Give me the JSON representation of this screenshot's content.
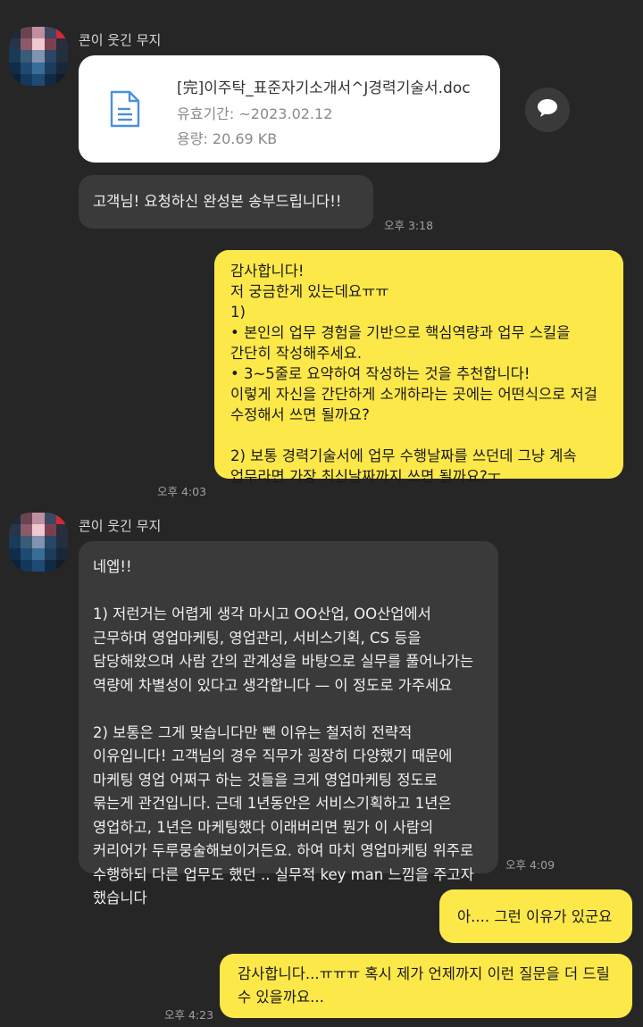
{
  "messages": [
    {
      "sender": "콘이 웃긴 무지",
      "file": {
        "name": "[完]이주탁_표준자기소개서^J경력기술서.doc",
        "expiry": "유효기간: ~2023.02.12",
        "size": "용량: 20.69 KB"
      }
    },
    {
      "text": "고객님! 요청하신 완성본 송부드립니다!!",
      "time": "오후 3:18"
    },
    {
      "text": "감사합니다!\n저 궁금한게 있는데요ㅠㅠ\n1)\n• 본인의 업무 경험을 기반으로 핵심역량과 업무 스킬을 간단히 작성해주세요.\n• 3~5줄로 요약하여 작성하는 것을 추천합니다!\n이렇게 자신을 간단하게 소개하라는 곳에는 어떤식으로 저걸 수정해서 쓰면 될까요?\n\n2) 보통 경력기술서에 업무 수행날짜를 쓰던데 그냥 계속 업무라면 가장 최신날짜까지 쓰면 될까요?ㅜ",
      "time": "오후 4:03"
    },
    {
      "sender": "콘이 웃긴 무지",
      "text": "네엡!!\n\n1) 저런거는 어렵게 생각 마시고 OO산업, OO산업에서 근무하며 영업마케팅, 영업관리, 서비스기획, CS 등을 담당해왔으며 사람 간의 관계성을 바탕으로 실무를 풀어나가는 역량에 차별성이 있다고 생각합니다 — 이 정도로 가주세요\n\n2) 보통은 그게 맞습니다만 뺀 이유는 철저히 전략적 이유입니다! 고객님의 경우 직무가 굉장히 다양했기 때문에 마케팅 영업 어쩌구 하는 것들을 크게 영업마케팅 정도로 묶는게 관건입니다. 근데 1년동안은 서비스기획하고 1년은 영업하고, 1년은 마케팅했다 이래버리면 뭔가 이 사람의 커리어가 두루뭉술해보이거든요. 하여 마치 영업마케팅 위주로 수행하되 다른 업무도 했던 .. 실무적 key man 느낌을 주고자 했습니다",
      "time": "오후 4:09"
    },
    {
      "text": "아.... 그런 이유가 있군요"
    },
    {
      "text": "감사합니다...ㅠㅠㅠ 혹시 제가 언제까지 이런 질문을 더 드릴 수 있을까요...",
      "time": "오후 4:23"
    }
  ],
  "icons": {
    "file": "document-icon",
    "share": "speech-bubble-icon"
  },
  "colors": {
    "background": "#262626",
    "incoming_bubble": "#3a3a3a",
    "outgoing_bubble": "#fde84a",
    "file_card": "#ffffff",
    "file_icon": "#4a90d9"
  }
}
